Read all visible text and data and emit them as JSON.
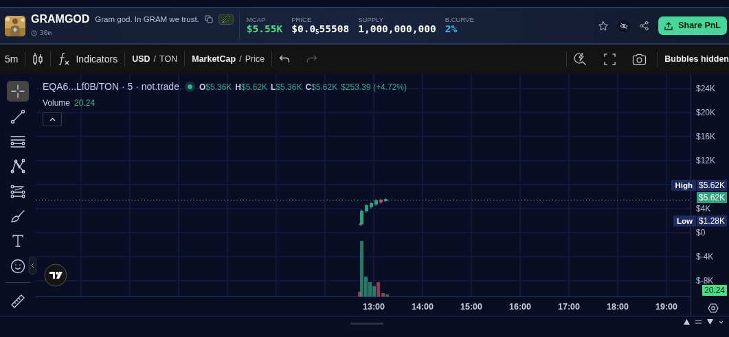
{
  "token": {
    "name": "GRAMGOD",
    "tagline": "Gram god. In GRAM we trust.",
    "age": "30m"
  },
  "stats": [
    {
      "label": "MCAP",
      "value": "$5.55K",
      "color": "#4ade80"
    },
    {
      "label": "PRICE",
      "value": "$0.0$_{5}$55508",
      "color": "#ffffff"
    },
    {
      "label": "SUPPLY",
      "value": "1,000,000,000",
      "color": "#ffffff"
    },
    {
      "label": "B.CURVE",
      "value": "2%",
      "color": "#38bdf8"
    }
  ],
  "share_button": "Share PnL",
  "toolbar": {
    "interval": "5m",
    "indicators": "Indicators",
    "currency": [
      {
        "label": "USD",
        "selected": true
      },
      {
        "label": "TON",
        "selected": false
      }
    ],
    "currency_separator": "/",
    "mode": [
      {
        "label": "MarketCap",
        "selected": true
      },
      {
        "label": "Price",
        "selected": false
      }
    ],
    "mode_separator": "/",
    "redo_disabled": true,
    "bubbles": "Bubbles hidden"
  },
  "tools": [
    {
      "kind": "crosshair",
      "selected": true
    },
    {
      "kind": "trendline",
      "selected": false
    },
    {
      "kind": "fib",
      "selected": false
    },
    {
      "kind": "pattern",
      "selected": false
    },
    {
      "kind": "projection",
      "selected": false
    },
    {
      "kind": "brush",
      "selected": false
    },
    {
      "kind": "text",
      "selected": false
    },
    {
      "kind": "emoji",
      "selected": false
    },
    {
      "kind": "ruler",
      "selected": false
    }
  ],
  "legend": {
    "symbol": "EQA6...Lf0B/TON · 5 · not.trade",
    "ohlc": [
      {
        "key": "O",
        "value": "$5.36K"
      },
      {
        "key": "H",
        "value": "$5.62K"
      },
      {
        "key": "L",
        "value": "$5.36K"
      },
      {
        "key": "C",
        "value": "$5.62K"
      }
    ],
    "change": "$253.39 (+4.72%)",
    "volume_label": "Volume",
    "volume": "20.24"
  },
  "price_axis": {
    "ticks": [
      "$24K",
      "$20K",
      "$16K",
      "$12K",
      "$4K",
      "$0",
      "$-4K",
      "$-8K"
    ],
    "markers": [
      {
        "kind": "high",
        "label": "High",
        "value": "$5.62K"
      },
      {
        "kind": "last",
        "value": "$5.62K"
      },
      {
        "kind": "low",
        "label": "Low",
        "value": "$1.28K"
      },
      {
        "kind": "volume",
        "value": "20.24"
      }
    ]
  },
  "time_axis": [
    "13:00",
    "14:00",
    "15:00",
    "16:00",
    "17:00",
    "18:00",
    "19:00"
  ]
}
